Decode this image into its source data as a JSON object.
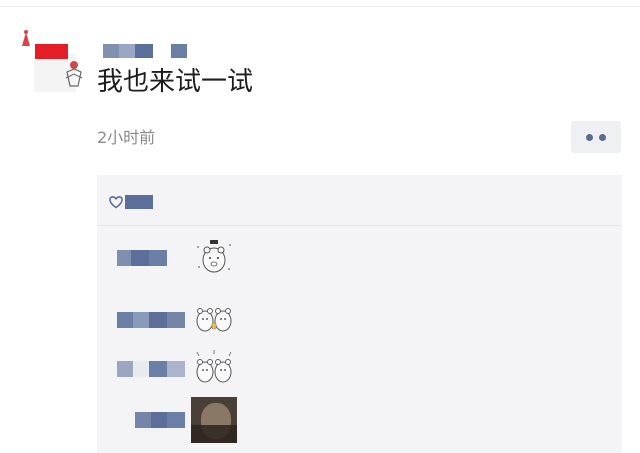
{
  "post": {
    "text": "我也来试一试",
    "time": "2小时前"
  },
  "icons": {
    "avatar": "avatar-image",
    "more": "more-dots-icon",
    "like": "heart-icon",
    "sticker_1": "bear-sticker-icon",
    "sticker_2": "bear-pair-sticker-icon",
    "sticker_3": "bear-pair-heart-sticker-icon",
    "sticker_4": "photo-sticker"
  },
  "colors": {
    "name_blue": "#5b6f9a",
    "avatar_red": "#e41e26",
    "comment_bg": "#f4f4f6"
  }
}
